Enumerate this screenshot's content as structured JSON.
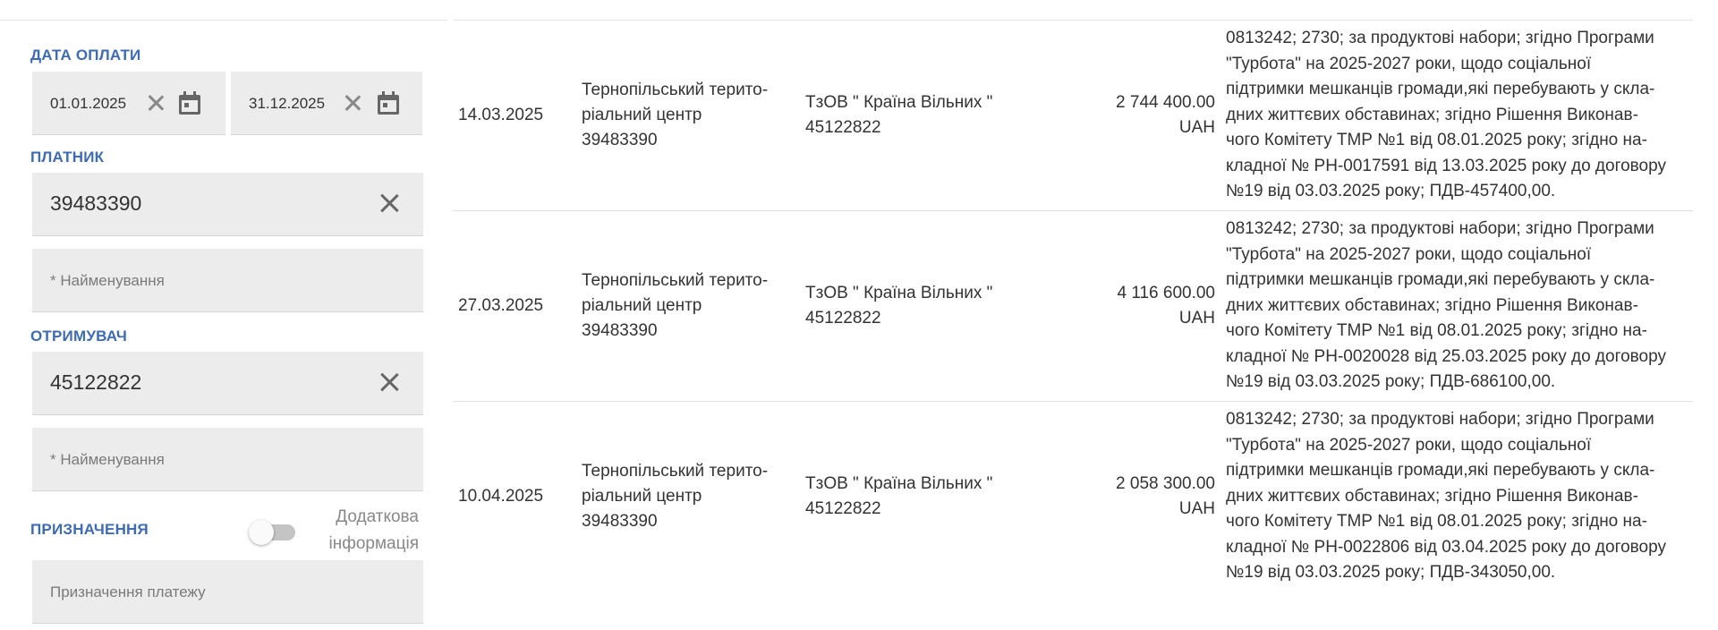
{
  "filters": {
    "payment_date": {
      "label": "ДАТА ОПЛАТИ",
      "from": "01.01.2025",
      "to": "31.12.2025"
    },
    "payer": {
      "label": "ПЛАТНИК",
      "code": "39483390",
      "name_placeholder": "* Найменування"
    },
    "recipient": {
      "label": "ОТРИМУВАЧ",
      "code": "45122822",
      "name_placeholder": "* Найменування"
    },
    "purpose": {
      "label": "ПРИЗНАЧЕННЯ",
      "toggle_label_line1": "Додаткова",
      "toggle_label_line2": "інформація",
      "toggle_on": false,
      "placeholder": "Призначення платежу"
    }
  },
  "transactions": [
    {
      "date": "14.03.2025",
      "payer": [
        "Тернопільський терито-",
        "ріальний центр",
        "39483390"
      ],
      "recipient": [
        "ТзОВ \" Країна Вільних \"",
        "45122822"
      ],
      "amount": "2 744 400.00",
      "currency": "UAH",
      "description": [
        "0813242; 2730; за продуктові набори; згідно Програми",
        "\"Турбота\" на 2025-2027 роки, щодо соціальної",
        "підтримки мешканців громади,які перебувають у скла-",
        "дних життєвих обставинах; згідно Рішення Виконав-",
        "чого Комітету ТМР №1 від 08.01.2025 року; згідно на-",
        "кладної № РН-0017591 від 13.03.2025 року до договору",
        "№19 від 03.03.2025 року; ПДВ-457400,00."
      ]
    },
    {
      "date": "27.03.2025",
      "payer": [
        "Тернопільський терито-",
        "ріальний центр",
        "39483390"
      ],
      "recipient": [
        "ТзОВ \" Країна Вільних \"",
        "45122822"
      ],
      "amount": "4 116 600.00",
      "currency": "UAH",
      "description": [
        "0813242; 2730; за продуктові набори; згідно Програми",
        "\"Турбота\" на 2025-2027 роки, щодо соціальної",
        "підтримки мешканців громади,які перебувають у скла-",
        "дних життєвих обставинах; згідно Рішення Виконав-",
        "чого Комітету ТМР №1 від 08.01.2025 року; згідно на-",
        "кладної № РН-0020028 від 25.03.2025 року до договору",
        "№19 від 03.03.2025 року; ПДВ-686100,00."
      ]
    },
    {
      "date": "10.04.2025",
      "payer": [
        "Тернопільський терито-",
        "ріальний центр",
        "39483390"
      ],
      "recipient": [
        "ТзОВ \" Країна Вільних \"",
        "45122822"
      ],
      "amount": "2 058 300.00",
      "currency": "UAH",
      "description": [
        "0813242; 2730; за продуктові набори; згідно Програми",
        "\"Турбота\" на 2025-2027 роки, щодо соціальної",
        "підтримки мешканців громади,які перебувають у скла-",
        "дних життєвих обставинах; згідно Рішення Виконав-",
        "чого Комітету ТМР №1 від 08.01.2025 року; згідно на-",
        "кладної № РН-0022806 від 03.04.2025 року до договору",
        "№19 від 03.03.2025 року; ПДВ-343050,00."
      ]
    }
  ],
  "colors": {
    "label": "#3d6bb5",
    "field_bg": "#ececec",
    "text": "#333333",
    "placeholder": "#7a7a7a"
  },
  "icons": [
    "close-icon",
    "calendar-icon"
  ]
}
